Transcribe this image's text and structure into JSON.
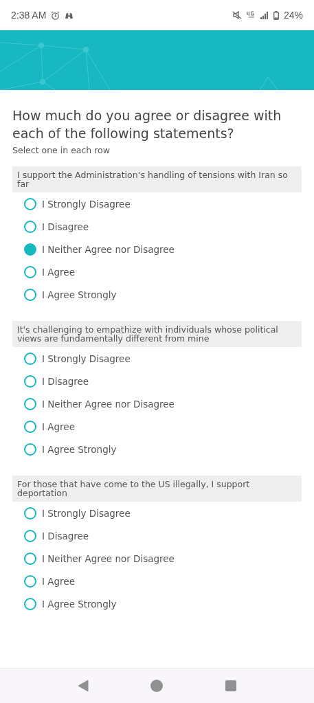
{
  "status_bar": {
    "time": "2:38 AM",
    "battery": "24%"
  },
  "question": {
    "title": "How much do you agree or disagree with each of the following statements?",
    "instruction": "Select one in each row"
  },
  "rows": [
    {
      "statement": "I support the Administration’s handling of tensions with Iran so far",
      "options": [
        {
          "label": "I Strongly Disagree",
          "selected": false
        },
        {
          "label": "I Disagree",
          "selected": false
        },
        {
          "label": "I Neither Agree nor Disagree",
          "selected": true
        },
        {
          "label": "I Agree",
          "selected": false
        },
        {
          "label": "I Agree Strongly",
          "selected": false
        }
      ]
    },
    {
      "statement": "It's challenging to empathize with individuals whose political views are fundamentally different from mine",
      "options": [
        {
          "label": "I Strongly Disagree",
          "selected": false
        },
        {
          "label": "I Disagree",
          "selected": false
        },
        {
          "label": "I Neither Agree nor Disagree",
          "selected": false
        },
        {
          "label": "I Agree",
          "selected": false
        },
        {
          "label": "I Agree Strongly",
          "selected": false
        }
      ]
    },
    {
      "statement": "For those that have come to the US illegally, I support deportation",
      "options": [
        {
          "label": "I Strongly Disagree",
          "selected": false
        },
        {
          "label": "I Disagree",
          "selected": false
        },
        {
          "label": "I Neither Agree nor Disagree",
          "selected": false
        },
        {
          "label": "I Agree",
          "selected": false
        },
        {
          "label": "I Agree Strongly",
          "selected": false
        }
      ]
    }
  ]
}
